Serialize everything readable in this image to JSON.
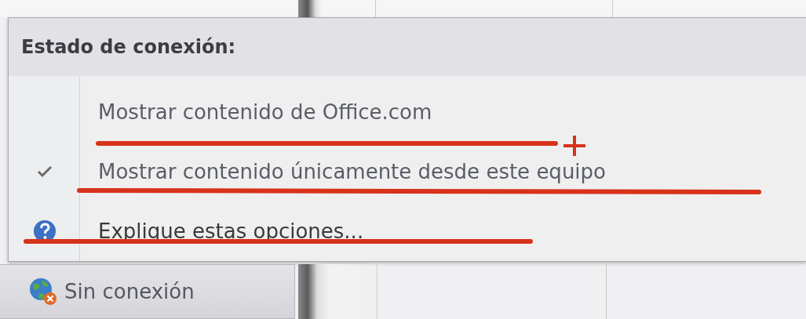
{
  "menu": {
    "title": "Estado de conexión:",
    "items": [
      {
        "kind": "option",
        "label": "Mostrar contenido de Office.com",
        "checked": false
      },
      {
        "kind": "option",
        "label": "Mostrar contenido únicamente desde este equipo",
        "checked": true
      },
      {
        "kind": "help",
        "label": "Explique estas opciones..."
      }
    ]
  },
  "status_button": {
    "label": "Sin conexión"
  }
}
